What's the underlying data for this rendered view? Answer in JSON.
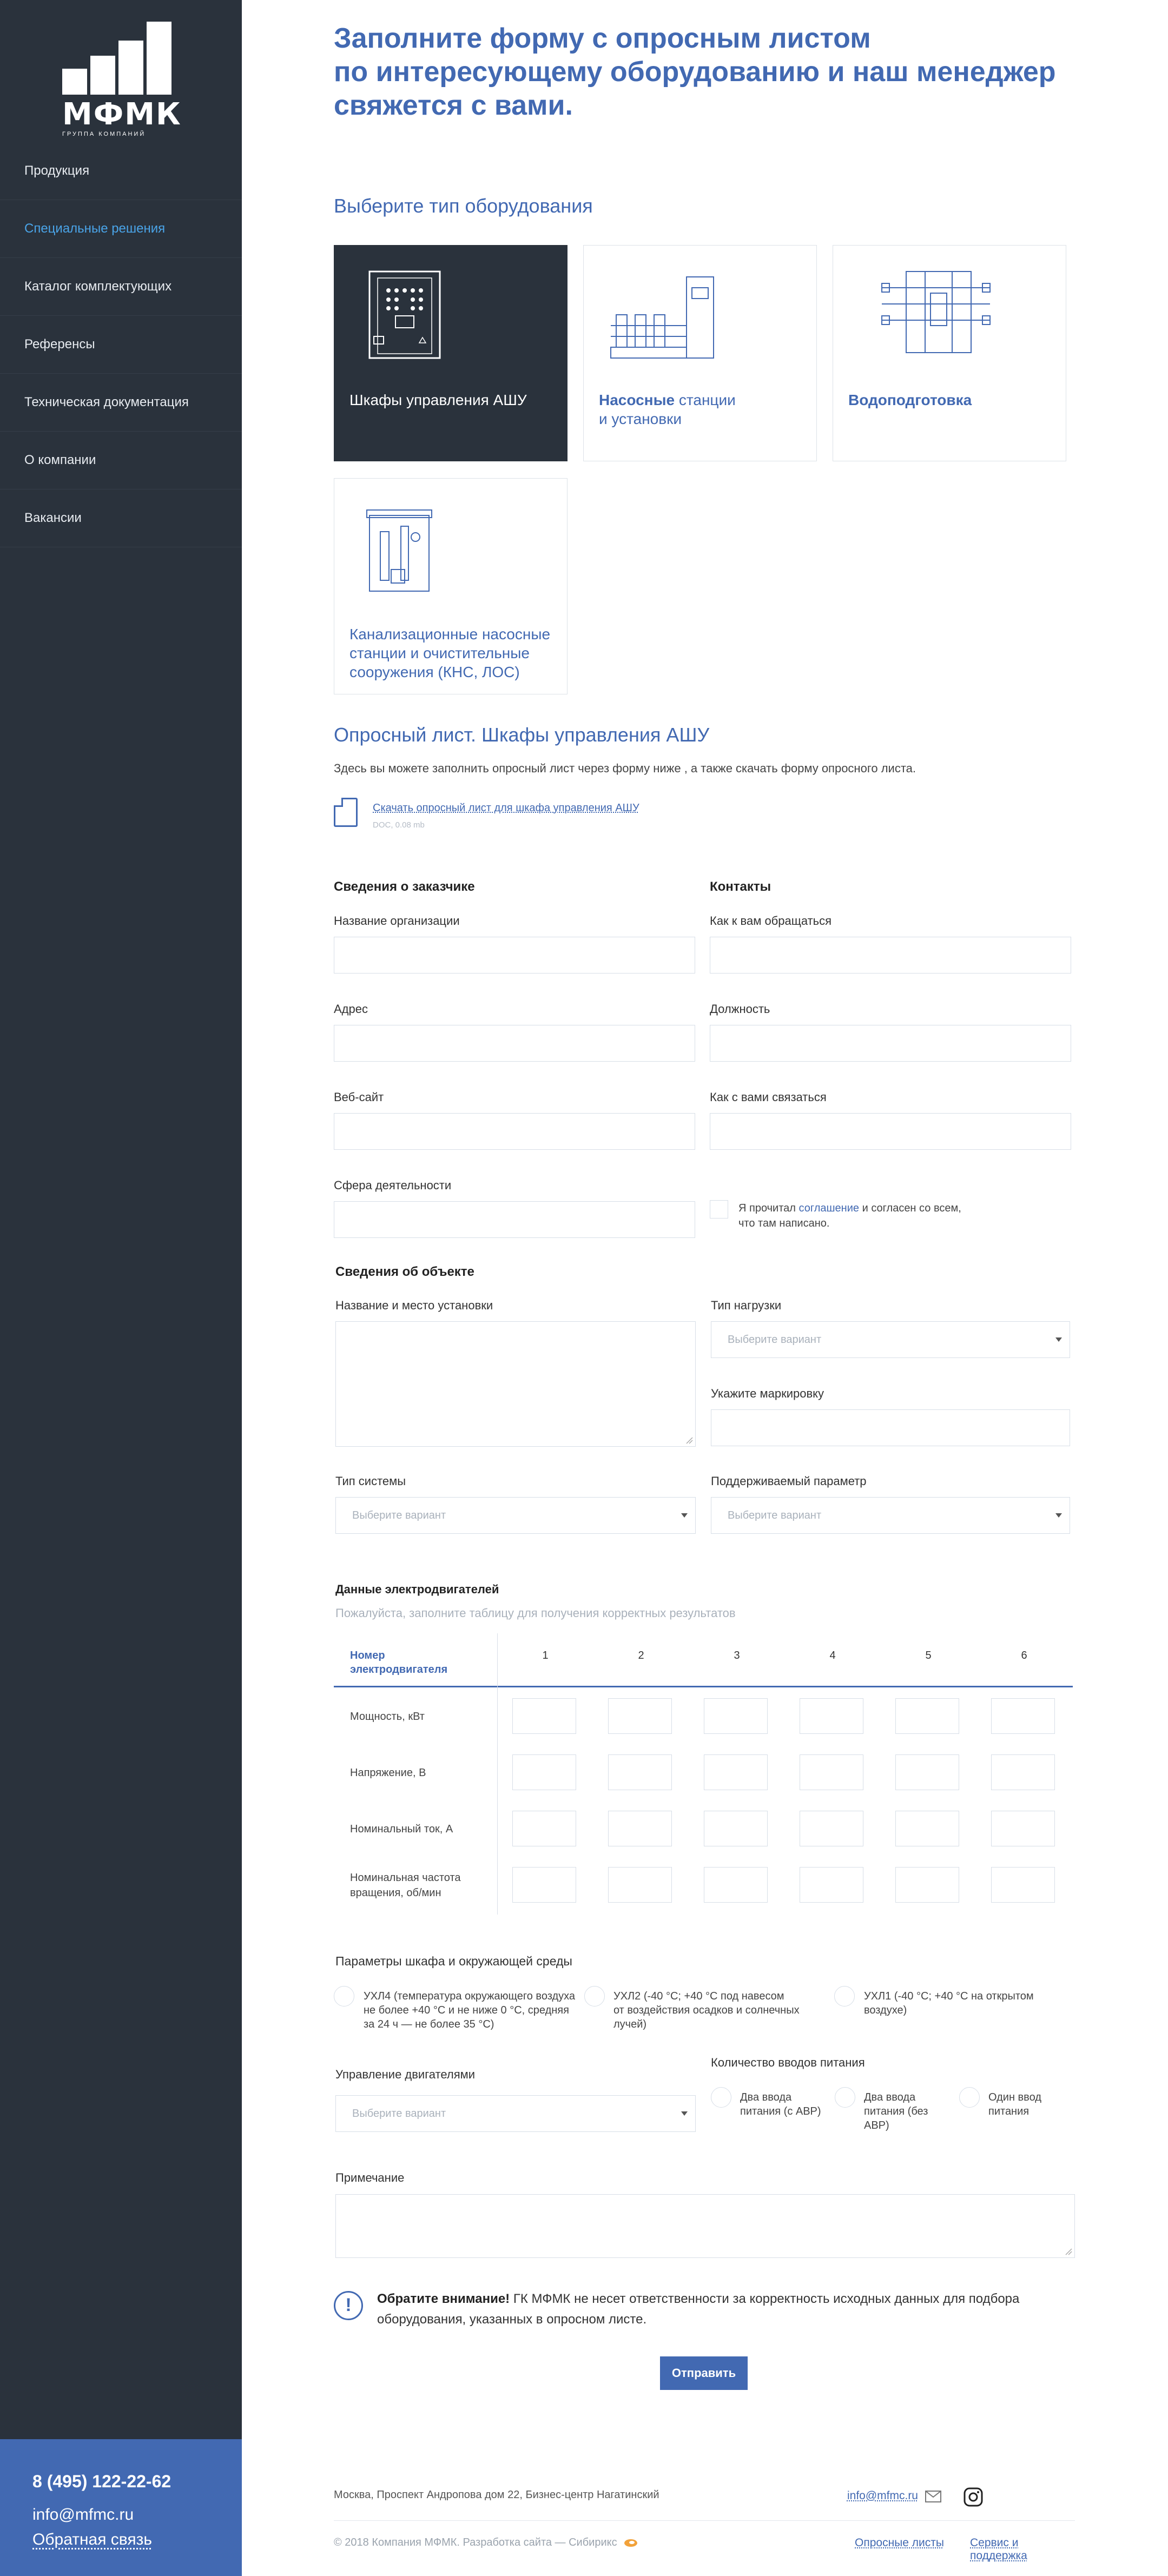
{
  "logo": {
    "name": "МФМК",
    "tagline": "ГРУППА КОМПАНИЙ"
  },
  "nav": [
    {
      "label": "Продукция"
    },
    {
      "label": "Специальные решения"
    },
    {
      "label": "Каталог комплектующих"
    },
    {
      "label": "Референсы"
    },
    {
      "label": "Техническая документация"
    },
    {
      "label": "О компании"
    },
    {
      "label": "Вакансии"
    }
  ],
  "sidebar_contacts": {
    "phone": "8 (495) 122-22-62",
    "email": "info@mfmc.ru",
    "feedback": "Обратная связь"
  },
  "page": {
    "title_lines": [
      "Заполните форму с опросным листом",
      "по интересующему оборудованию и наш менеджер",
      "свяжется с вами."
    ],
    "equipment_heading": "Выберите тип оборудования",
    "equipment": [
      {
        "label": "Шкафы управления АШУ",
        "selected": true
      },
      {
        "label_bold": "Насосные",
        "label_rest": " станции",
        "label_line2": "и установки"
      },
      {
        "label_bold": "Водоподготовка"
      },
      {
        "label_lines": [
          "Канализационные насосные",
          "станции и очистительные",
          "сооружения (КНС, ЛОС)"
        ]
      }
    ],
    "questionnaire_heading": "Опросный лист. Шкафы управления АШУ",
    "intro": "Здесь вы можете заполнить опросный лист через форму ниже , а также скачать форму опросного листа.",
    "download": {
      "link": "Скачать опросный лист для шкафа управления АШУ",
      "meta": "DOC, 0.08 mb"
    }
  },
  "customer": {
    "heading": "Сведения о заказчике",
    "fields": [
      "Название организации",
      "Адрес",
      "Веб-сайт",
      "Сфера деятельности"
    ]
  },
  "contacts": {
    "heading": "Контакты",
    "fields": [
      "Как к вам обращаться",
      "Должность",
      "Как с вами связаться"
    ],
    "agree_pre": "Я прочитал ",
    "agree_link": "соглашение",
    "agree_post": " и согласен со всем,",
    "agree_line2": "что там написано."
  },
  "object": {
    "heading": "Сведения об объекте",
    "install_label": "Название и место установки",
    "load_label": "Тип нагрузки",
    "marking_label": "Укажите маркировку",
    "system_label": "Тип системы",
    "param_label": "Поддерживаемый параметр",
    "select_placeholder": "Выберите вариант"
  },
  "motors": {
    "heading": "Данные электродвигателей",
    "hint": "Пожалуйста, заполните таблицу для получения корректных результатов",
    "col_header": [
      "Номер",
      "электродвигателя"
    ],
    "columns": [
      "1",
      "2",
      "3",
      "4",
      "5",
      "6"
    ],
    "rows": [
      {
        "label": [
          "Мощность, кВт"
        ]
      },
      {
        "label": [
          "Напряжение, В"
        ]
      },
      {
        "label": [
          "Номинальный ток, А"
        ]
      },
      {
        "label": [
          "Номинальная частота",
          "вращения, об/мин"
        ]
      }
    ]
  },
  "cabinet": {
    "heading": "Параметры шкафа и окружающей среды",
    "options": [
      {
        "lines": [
          "УХЛ4 (температура окружающего воздуха",
          "не более +40 °С и не ниже 0 °С, средняя",
          "за 24 ч — не более 35 °С)"
        ]
      },
      {
        "lines": [
          "УХЛ2 (-40 °С; +40 °С под навесом",
          "от воздействия осадков и солнечных",
          "лучей)"
        ]
      },
      {
        "lines": [
          "УХЛ1 (-40 °С; +40 °С на открытом",
          "воздухе)"
        ]
      }
    ],
    "motor_control_label": "Управление двигателями",
    "power_inputs_label": "Количество вводов питания",
    "power_options": [
      {
        "lines": [
          "Два ввода",
          "питания (с АВР)"
        ]
      },
      {
        "lines": [
          "Два ввода",
          "питания (без",
          "АВР)"
        ]
      },
      {
        "lines": [
          "Один ввод",
          "питания"
        ]
      }
    ]
  },
  "note": {
    "label": "Примечание"
  },
  "warning": {
    "bold": "Обратите внимание!",
    "text1": " ГК МФМК не несет ответственности за корректность исходных данных для подбора",
    "text2": "оборудования, указанных в опросном листе."
  },
  "submit": "Отправить",
  "footer": {
    "address": "Москва, Проспект Андропова дом 22, Бизнес-центр Нагатинский",
    "email": "info@mfmc.ru",
    "copyright": "© 2018 Компания МФМК. Разработка сайта — Сибирикс",
    "links": [
      "Опросные листы",
      "Сервис и поддержка"
    ]
  },
  "colors": {
    "accent": "#4269b2",
    "sidebar": "#2a323c",
    "link_active": "#4aa4e8"
  }
}
